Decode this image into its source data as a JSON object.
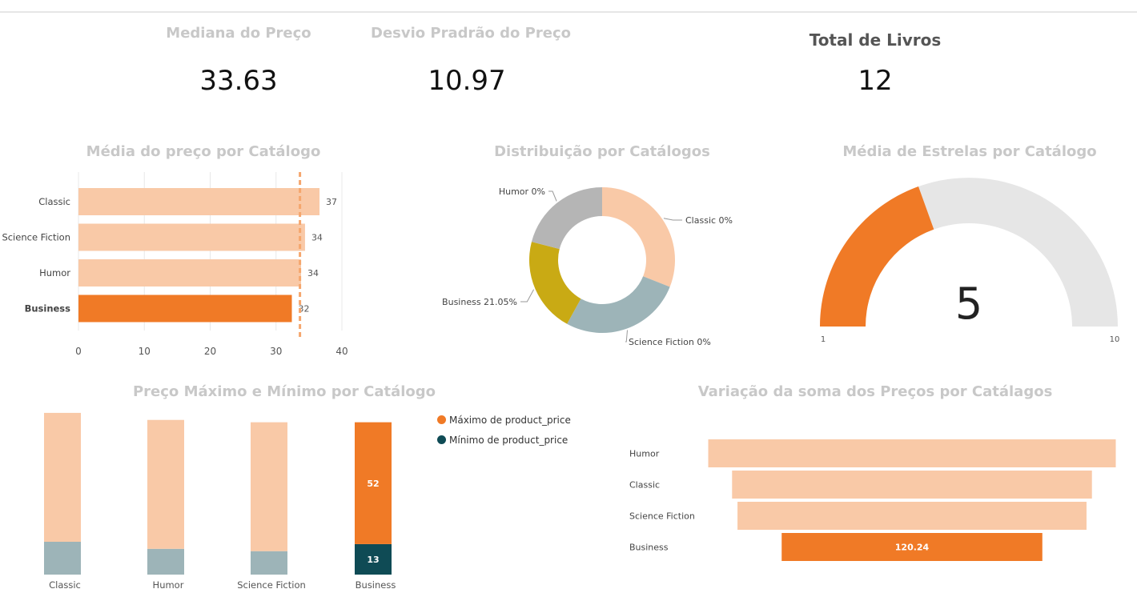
{
  "kpis": {
    "median": {
      "label": "Mediana do Preço",
      "value": "33.63"
    },
    "stddev": {
      "label": "Desvio Pradrão do Preço",
      "value": "10.97"
    },
    "total": {
      "label": "Total de Livros",
      "value": "12"
    }
  },
  "colors": {
    "peach": "#f9c9a7",
    "orange": "#f07a26",
    "teal": "#9db4b8",
    "darkteal": "#0f4b55",
    "gray": "#b5b5b5",
    "mustard": "#c9aa14",
    "lightgray": "#e6e6e6"
  },
  "chart_data": [
    {
      "id": "avg_price",
      "type": "bar",
      "orientation": "horizontal",
      "title": "Média do preço por  Catálogo",
      "categories": [
        "Classic",
        "Science Fiction",
        "Humor",
        "Business"
      ],
      "values": [
        36.6,
        34.4,
        33.8,
        32.4
      ],
      "data_labels": [
        "37",
        "34",
        "34",
        "32"
      ],
      "highlight": "Business",
      "reference_line": 33.63,
      "xlim": [
        0,
        40
      ],
      "xticks": [
        "0",
        "10",
        "20",
        "30",
        "40"
      ],
      "grid": true
    },
    {
      "id": "distribution",
      "type": "pie",
      "variant": "donut",
      "title": "Distribuição por Catálogos",
      "slices": [
        {
          "label": "Classic 0%",
          "value": 31,
          "color": "#f9c9a7"
        },
        {
          "label": "Science Fiction 0%",
          "value": 27,
          "color": "#9db4b8"
        },
        {
          "label": "Business 21.05%",
          "value": 21.05,
          "color": "#c9aa14"
        },
        {
          "label": "Humor 0%",
          "value": 20.95,
          "color": "#b5b5b5"
        }
      ]
    },
    {
      "id": "stars_gauge",
      "type": "gauge",
      "title": "Média de Estrelas por Catálogo",
      "value": 5,
      "value_label": "5",
      "min": 1,
      "max": 10,
      "min_label": "1",
      "max_label": "10",
      "fill_fraction": 0.39
    },
    {
      "id": "max_min",
      "type": "bar",
      "stacked": true,
      "title": "Preço Máximo e Mínimo por Catálogo",
      "categories": [
        "Classic",
        "Humor",
        "Science Fiction",
        "Business"
      ],
      "highlight": "Business",
      "ylim": [
        0,
        70
      ],
      "series": [
        {
          "name": "Mínimo de product_price",
          "values": [
            14,
            11,
            10,
            13
          ]
        },
        {
          "name": "Máximo de product_price",
          "values": [
            55,
            55,
            55,
            52
          ]
        }
      ],
      "data_labels": {
        "Business": {
          "max": "52",
          "min": "13"
        }
      },
      "legend": "top-right"
    },
    {
      "id": "funnel",
      "type": "funnel",
      "title": "Variação da soma dos Preços por Catálagos",
      "categories": [
        "Humor",
        "Classic",
        "Science Fiction",
        "Business"
      ],
      "values": [
        188,
        166,
        161,
        120.24
      ],
      "highlight": "Business",
      "data_labels": {
        "Business": "120.24"
      }
    }
  ]
}
